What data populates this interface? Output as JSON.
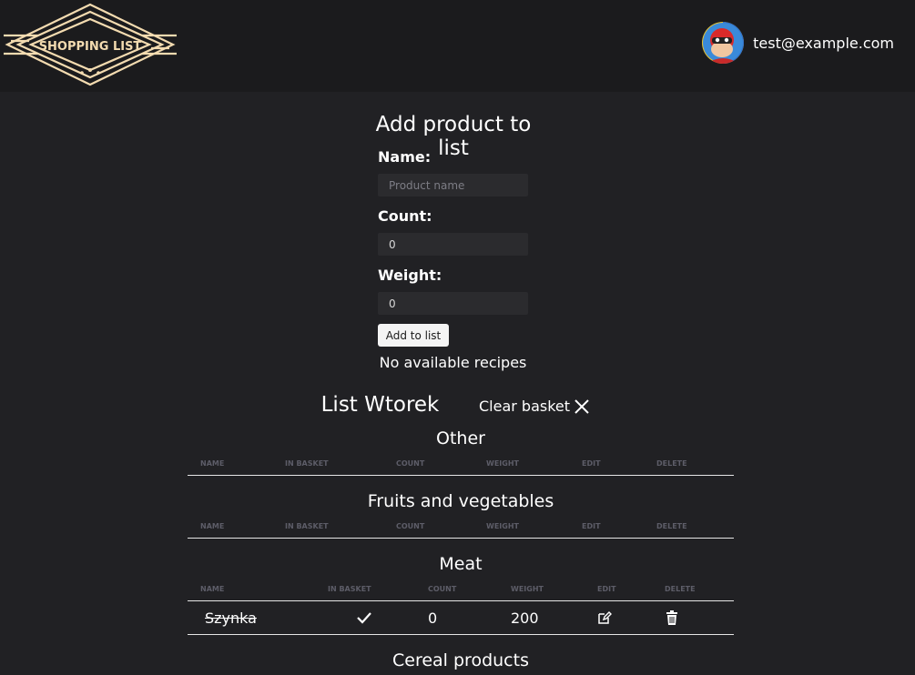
{
  "header": {
    "logo_text": "SHOPPING LIST",
    "user_email": "test@example.com",
    "avatar_icon": "superhero-avatar-icon"
  },
  "form": {
    "title": "Add product to list",
    "name_label": "Name:",
    "name_placeholder": "Product name",
    "name_value": "",
    "count_label": "Count:",
    "count_value": "0",
    "weight_label": "Weight:",
    "weight_value": "0",
    "add_button": "Add to list",
    "recipes_text": "No available recipes"
  },
  "list": {
    "title": "List Wtorek",
    "clear_basket": "Clear basket",
    "columns": [
      "NAME",
      "IN BASKET",
      "COUNT",
      "WEIGHT",
      "EDIT",
      "DELETE"
    ],
    "categories": [
      {
        "name": "Other",
        "items": []
      },
      {
        "name": "Fruits and vegetables",
        "items": []
      },
      {
        "name": "Meat",
        "items": [
          {
            "name": "Szynka",
            "in_basket": true,
            "count": "0",
            "weight": "200"
          }
        ]
      },
      {
        "name": "Cereal products",
        "items": []
      }
    ]
  },
  "colors": {
    "background": "#212124",
    "topbar": "#1b1b1d",
    "logo_gold": "#f3dbb0",
    "header_text": "#5d5d68"
  }
}
